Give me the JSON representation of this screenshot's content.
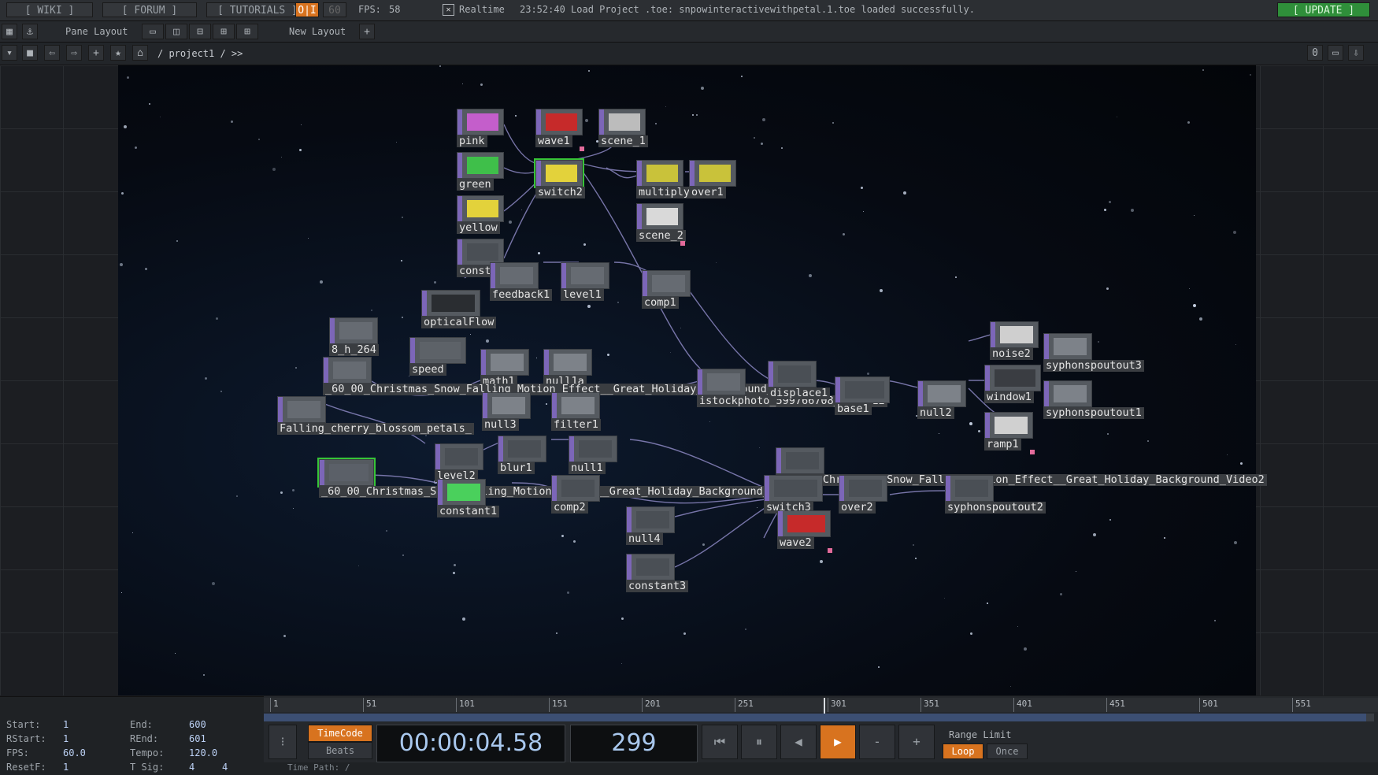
{
  "topbar": {
    "wiki": "[ WIKI ]",
    "forum": "[ FORUM ]",
    "tutorials": "[ TUTORIALS ]",
    "fps_mode": "O|I",
    "fps_target": "60",
    "fps_label": "FPS:",
    "fps_value": "58",
    "realtime_label": "Realtime",
    "status_message": "23:52:40 Load Project .toe: snpowinteractivewithpetal.1.toe loaded successfully.",
    "update": "[ UPDATE ]"
  },
  "toolbar": {
    "pane_layout": "Pane Layout",
    "new_layout": "New Layout",
    "add": "+"
  },
  "pathbar": {
    "path": "/ project1 / >>",
    "counter": "0"
  },
  "nodes": [
    {
      "id": "pink",
      "label": "pink"
    },
    {
      "id": "green",
      "label": "green"
    },
    {
      "id": "yellow",
      "label": "yellow"
    },
    {
      "id": "const",
      "label": "const"
    },
    {
      "id": "wave1",
      "label": "wave1"
    },
    {
      "id": "switch2",
      "label": "switch2"
    },
    {
      "id": "scene1",
      "label": "scene_1"
    },
    {
      "id": "multiply",
      "label": "multiply"
    },
    {
      "id": "over1",
      "label": "over1"
    },
    {
      "id": "scene2",
      "label": "scene_2"
    },
    {
      "id": "feedback1",
      "label": "feedback1"
    },
    {
      "id": "level1",
      "label": "level1"
    },
    {
      "id": "comp1",
      "label": "comp1"
    },
    {
      "id": "opticalflow",
      "label": "opticalFlow"
    },
    {
      "id": "h264",
      "label": "8_h_264"
    },
    {
      "id": "speed",
      "label": "speed"
    },
    {
      "id": "math1",
      "label": "math1"
    },
    {
      "id": "null1a",
      "label": "null1a"
    },
    {
      "id": "xmas1",
      "label": "_60_00_Christmas_Snow_Falling_Motion_Effect__Great_Holiday_Background_Video"
    },
    {
      "id": "cherry",
      "label": "Falling_cherry_blossom_petals_"
    },
    {
      "id": "null3",
      "label": "null3"
    },
    {
      "id": "filter1",
      "label": "filter1"
    },
    {
      "id": "istock",
      "label": "istockphoto_599766708_612x612"
    },
    {
      "id": "displace1",
      "label": "displace1"
    },
    {
      "id": "base1",
      "label": "base1"
    },
    {
      "id": "null2",
      "label": "null2"
    },
    {
      "id": "noise2",
      "label": "noise2"
    },
    {
      "id": "spout3",
      "label": "syphonspoutout3"
    },
    {
      "id": "window1",
      "label": "window1"
    },
    {
      "id": "spout1",
      "label": "syphonspoutout1"
    },
    {
      "id": "ramp1",
      "label": "ramp1"
    },
    {
      "id": "level2",
      "label": "level2"
    },
    {
      "id": "blur1",
      "label": "blur1"
    },
    {
      "id": "null1",
      "label": "null1"
    },
    {
      "id": "xmas2",
      "label": "_60_00_Christmas_Snow_Falling_Motion_Effect__Great_Holiday_Background_Video2"
    },
    {
      "id": "xmas3",
      "label": "_60_00_Christmas_Snow_Falling_Motion_Effect__Great_Holiday_Background_Video1"
    },
    {
      "id": "constant1",
      "label": "constant1"
    },
    {
      "id": "comp2",
      "label": "comp2"
    },
    {
      "id": "switch3",
      "label": "switch3"
    },
    {
      "id": "over2",
      "label": "over2"
    },
    {
      "id": "spout2",
      "label": "syphonspoutout2"
    },
    {
      "id": "null4",
      "label": "null4"
    },
    {
      "id": "wave2",
      "label": "wave2"
    },
    {
      "id": "constant3",
      "label": "constant3"
    }
  ],
  "stats": {
    "start_label": "Start:",
    "start": "1",
    "end_label": "End:",
    "end": "600",
    "rstart_label": "RStart:",
    "rstart": "1",
    "rend_label": "REnd:",
    "rend": "601",
    "fps_label": "FPS:",
    "fps": "60.0",
    "tempo_label": "Tempo:",
    "tempo": "120.0",
    "resetf_label": "ResetF:",
    "resetf": "1",
    "tsig_label": "T Sig:",
    "tsig_a": "4",
    "tsig_b": "4"
  },
  "timeline": {
    "ticks": [
      "1",
      "51",
      "101",
      "151",
      "201",
      "251",
      "301",
      "351",
      "401",
      "451",
      "501",
      "551"
    ],
    "timecode_btn": "TimeCode",
    "beats_btn": "Beats",
    "timecode": "00:00:04.58",
    "frame": "299",
    "range_limit": "Range Limit",
    "loop": "Loop",
    "once": "Once",
    "time_path": "Time Path: /",
    "minus": "-",
    "plus": "+"
  }
}
